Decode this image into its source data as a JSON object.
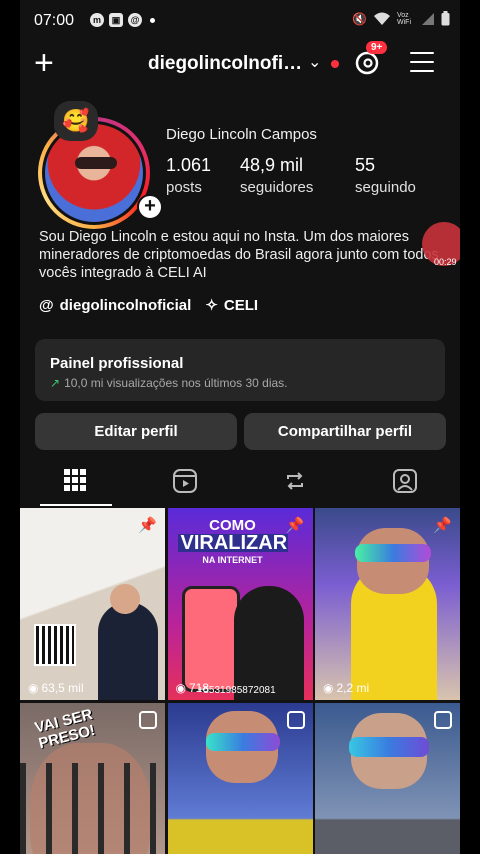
{
  "status_bar": {
    "time": "07:00",
    "left_icons": [
      "messenger-icon",
      "gallery-icon",
      "threads-icon",
      "dot-icon"
    ],
    "right_icons": [
      "mute-icon",
      "wifi-icon",
      "vowifi-icon",
      "signal-icon",
      "battery-icon"
    ],
    "vo_label": "Voz WiFi"
  },
  "top_bar": {
    "username": "diegolincolnofi…",
    "notifications_badge": "9+"
  },
  "profile": {
    "full_name": "Diego Lincoln Campos",
    "stats": [
      {
        "number": "1.061",
        "label": "posts"
      },
      {
        "number": "48,9 mil",
        "label": "seguidores"
      },
      {
        "number": "55",
        "label": "seguindo"
      }
    ],
    "bio": "Sou Diego Lincoln e estou aqui no Insta. Um dos maiores mineradores de criptomoedas do Brasil agora junto com todos vocês integrado à CELI AI",
    "recording_time": "00:29",
    "links": [
      {
        "icon": "threads-icon",
        "text": "diegolincolnoficial"
      },
      {
        "icon": "sparkle-icon",
        "text": "CELI"
      }
    ]
  },
  "professional_dashboard": {
    "title": "Painel profissional",
    "subtitle": "10,0 mi visualizações nos últimos 30 dias."
  },
  "buttons": {
    "edit_profile": "Editar perfil",
    "share_profile": "Compartilhar perfil"
  },
  "tabs": [
    {
      "name": "grid",
      "icon": "grid-icon",
      "active": true
    },
    {
      "name": "reels",
      "icon": "reels-icon",
      "active": false
    },
    {
      "name": "reposts",
      "icon": "repost-icon",
      "active": false
    },
    {
      "name": "tagged",
      "icon": "tagged-icon",
      "active": false
    }
  ],
  "posts": [
    {
      "pinned": true,
      "views": "63,5 mil"
    },
    {
      "pinned": true,
      "views": "718",
      "overlay_title": "COMO",
      "overlay_big": "VIRALIZAR",
      "overlay_small": "NA INTERNET",
      "phone": "+5531985872081"
    },
    {
      "pinned": true,
      "views": "2,2 mi"
    },
    {
      "caption": "VAI SER PRESO!",
      "reel": true
    },
    {
      "reel": true
    },
    {
      "reel": true
    }
  ],
  "colors": {
    "background": "#121212",
    "button_bg": "#363636",
    "badge_red": "#ff3040",
    "growth_green": "#3cc66f"
  }
}
